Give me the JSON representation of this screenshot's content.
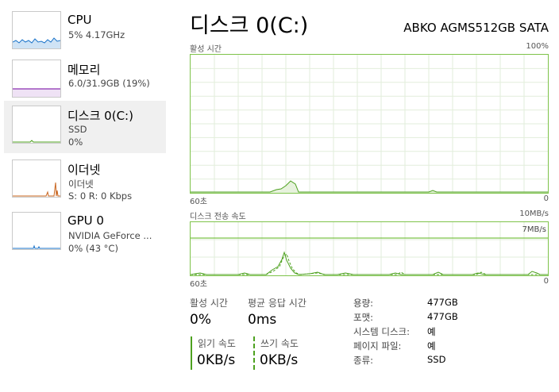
{
  "sidebar": {
    "items": [
      {
        "name": "CPU",
        "line1": "5%  4.17GHz",
        "line2": ""
      },
      {
        "name": "메모리",
        "line1": "6.0/31.9GB (19%)",
        "line2": ""
      },
      {
        "name": "디스크 0(C:)",
        "line1": "SSD",
        "line2": "0%"
      },
      {
        "name": "이더넷",
        "line1": "이더넷",
        "line2": "S: 0  R: 0 Kbps"
      },
      {
        "name": "GPU 0",
        "line1": "NVIDIA GeForce ...",
        "line2": "0% (43 °C)"
      }
    ]
  },
  "main": {
    "title": "디스크 0(C:)",
    "device": "ABKO AGMS512GB SATA",
    "graph1": {
      "label": "활성 시간",
      "max": "100%",
      "time": "60초",
      "min": "0"
    },
    "graph2": {
      "label": "디스크 전송 속도",
      "max": "10MB/s",
      "ref": "7MB/s",
      "time": "60초",
      "min": "0"
    },
    "stats": {
      "active_label": "활성 시간",
      "active_value": "0%",
      "response_label": "평균 응답 시간",
      "response_value": "0ms",
      "read_label": "읽기 속도",
      "read_value": "0KB/s",
      "write_label": "쓰기 속도",
      "write_value": "0KB/s"
    },
    "props": [
      {
        "label": "용량:",
        "value": "477GB"
      },
      {
        "label": "포맷:",
        "value": "477GB"
      },
      {
        "label": "시스템 디스크:",
        "value": "예"
      },
      {
        "label": "페이지 파일:",
        "value": "예"
      },
      {
        "label": "종류:",
        "value": "SSD"
      }
    ]
  },
  "colors": {
    "disk_green": "#4da11f",
    "grid": "#e2eedb",
    "cpu_blue": "#1a73c9",
    "memory_purple": "#8a2fb0",
    "ethernet_orange": "#c8641e",
    "selected_bg": "#f0f0f0"
  }
}
